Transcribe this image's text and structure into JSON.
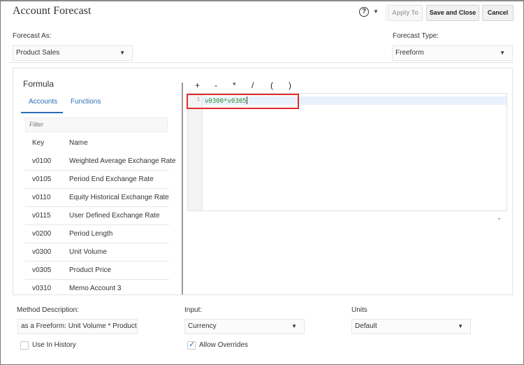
{
  "dialog": {
    "title": "Account Forecast",
    "help_icon": "question-circle-icon",
    "buttons": {
      "apply_to": "Apply To",
      "save_and_close": "Save and Close",
      "cancel": "Cancel"
    }
  },
  "forecast_as": {
    "label": "Forecast As:",
    "value": "Product Sales"
  },
  "forecast_type": {
    "label": "Forecast Type:",
    "value": "Freeform"
  },
  "formula": {
    "title": "Formula",
    "tabs": [
      {
        "label": "Accounts",
        "active": true
      },
      {
        "label": "Functions",
        "active": false
      }
    ],
    "filter_placeholder": "Filter",
    "table": {
      "columns": [
        "Key",
        "Name"
      ],
      "rows": [
        {
          "key": "v0100",
          "name": "Weighted Average Exchange Rate"
        },
        {
          "key": "v0105",
          "name": "Period End Exchange Rate"
        },
        {
          "key": "v0110",
          "name": "Equity Historical Exchange Rate"
        },
        {
          "key": "v0115",
          "name": "User Defined Exchange Rate"
        },
        {
          "key": "v0200",
          "name": "Period Length"
        },
        {
          "key": "v0300",
          "name": "Unit Volume"
        },
        {
          "key": "v0305",
          "name": "Product Price"
        },
        {
          "key": "v0310",
          "name": "Memo Account 3"
        }
      ]
    },
    "operators": [
      "+",
      "-",
      "*",
      "/",
      "(",
      ")"
    ],
    "editor": {
      "line_number": "1",
      "code": "v0300*v0305"
    },
    "highlight_color": "#e02b2b"
  },
  "method_description": {
    "label": "Method Description:",
    "value": "as a Freeform:  Unit Volume * Product"
  },
  "input": {
    "label": "Input:",
    "value": "Currency"
  },
  "units": {
    "label": "Units",
    "value": "Default"
  },
  "use_in_history": {
    "label": "Use In History",
    "checked": false
  },
  "allow_overrides": {
    "label": "Allow Overrides",
    "checked": true
  },
  "colors": {
    "accent": "#2a6db7",
    "code_green": "#3a8a2a"
  }
}
